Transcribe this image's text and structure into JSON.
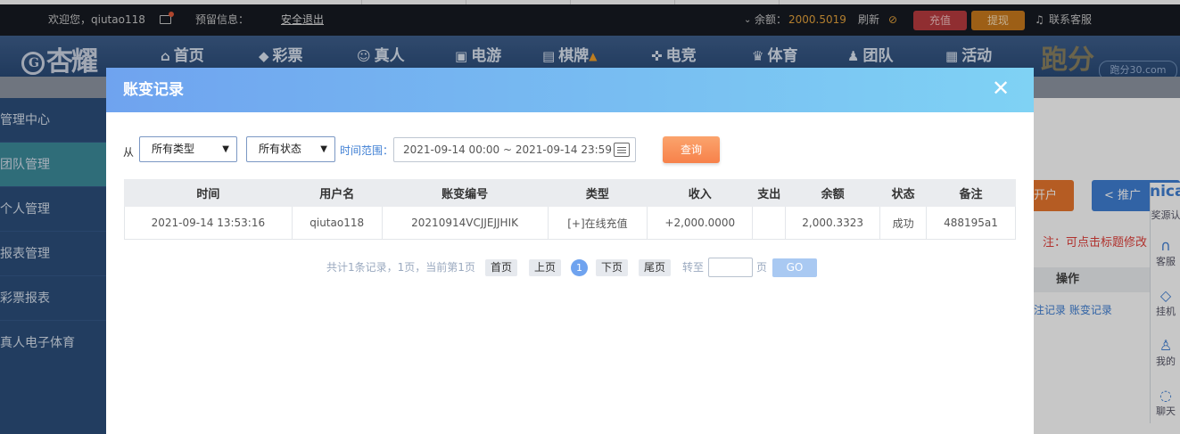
{
  "topbar": {
    "welcome": "欢迎您，qiutao118",
    "reserved_info": "预留信息：",
    "logout": "安全退出",
    "balance_label": "余额：",
    "balance_value": "2000.5019",
    "refresh": "刷新",
    "recharge": "充值",
    "withdraw": "提现",
    "support": "联系客服"
  },
  "nav": {
    "logo_text": "杏耀",
    "items": [
      {
        "label": "首页",
        "icon": "home-icon"
      },
      {
        "label": "彩票",
        "icon": "diamond-icon"
      },
      {
        "label": "真人",
        "icon": "person-icon"
      },
      {
        "label": "电游",
        "icon": "arcade-icon"
      },
      {
        "label": "棋牌",
        "icon": "cards-icon"
      },
      {
        "label": "电竞",
        "icon": "gamepad-icon"
      },
      {
        "label": "体育",
        "icon": "trophy-icon"
      },
      {
        "label": "团队",
        "icon": "team-icon"
      },
      {
        "label": "活动",
        "icon": "gift-icon"
      }
    ],
    "paofen": "跑分",
    "watermark": "跑分30.com"
  },
  "sidebar": {
    "items": [
      "管理中心",
      "团队管理",
      "个人管理",
      "报表管理",
      "彩票报表",
      "真人电子体育"
    ]
  },
  "right_pane": {
    "open_account": "开户",
    "promo": "推广",
    "note": "注：可点击标题修改",
    "operation_header": "操作",
    "links": "注记录  账变记录"
  },
  "float_panel": {
    "brand": "nica",
    "items": [
      "奖源认",
      "客服",
      "挂机",
      "我的",
      "聊天"
    ]
  },
  "modal": {
    "title": "账变记录",
    "close": "✕",
    "filter": {
      "from": "从",
      "type_select": "所有类型",
      "status_select": "所有状态",
      "time_label": "时间范围：",
      "date_range": "2021-09-14 00:00 ~ 2021-09-14 23:59",
      "query": "查询"
    },
    "table": {
      "headers": [
        "时间",
        "用户名",
        "账变编号",
        "类型",
        "收入",
        "支出",
        "余额",
        "状态",
        "备注"
      ],
      "rows": [
        [
          "2021-09-14 13:53:16",
          "qiutao118",
          "20210914VCJJEJJHIK",
          "[+]在线充值",
          "+2,000.0000",
          "",
          "2,000.3323",
          "成功",
          "488195a1"
        ]
      ]
    },
    "pager": {
      "summary": "共计1条记录，1页，当前第1页",
      "first": "首页",
      "prev": "上页",
      "current": "1",
      "next": "下页",
      "last": "尾页",
      "goto": "转至",
      "page_unit": "页",
      "go": "GO"
    }
  }
}
